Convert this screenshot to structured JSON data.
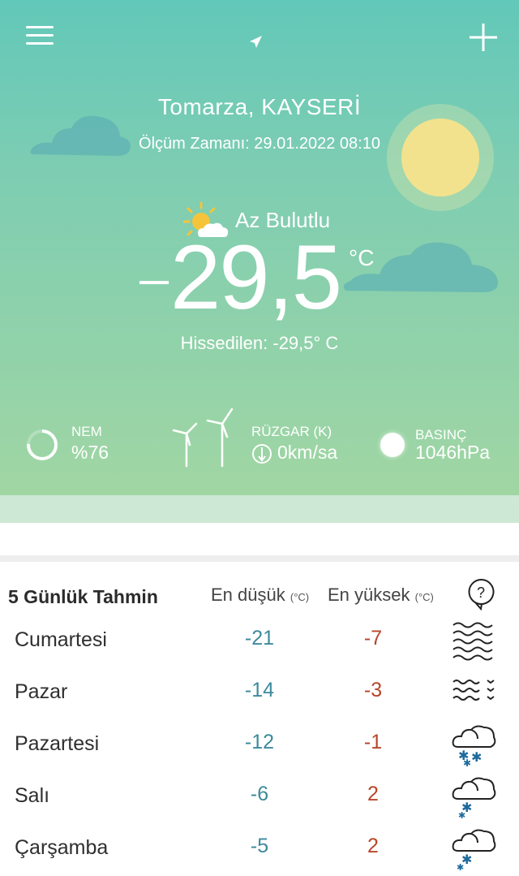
{
  "header": {
    "menu_icon": "hamburger-menu-icon",
    "location_icon": "location-arrow-icon",
    "add_icon": "plus-icon"
  },
  "location": {
    "city": "Tomarza,  KAYSERİ",
    "measurement_time": "Ölçüm Zamanı: 29.01.2022 08:10"
  },
  "current": {
    "condition": "Az Bulutlu",
    "condition_icon": "partly-cloudy-icon",
    "temperature": "29,5",
    "temperature_sign": "-",
    "unit": "°C",
    "feels_like": "Hissedilen: -29,5° C"
  },
  "stats": {
    "humidity_label": "NEM",
    "humidity_value": "%76",
    "humidity_percent": 76,
    "wind_label": "RÜZGAR (K)",
    "wind_value": "0km/sa",
    "pressure_label": "BASINÇ",
    "pressure_value": "1046hPa"
  },
  "forecast": {
    "title": "5 Günlük Tahmin",
    "low_header": "En düşük",
    "high_header": "En yüksek",
    "unit_header": "(°C)",
    "help_icon": "question-bubble-icon",
    "days": [
      {
        "day": "Cumartesi",
        "low": "-21",
        "high": "-7",
        "icon": "fog-icon"
      },
      {
        "day": "Pazar",
        "low": "-14",
        "high": "-3",
        "icon": "fog-icon"
      },
      {
        "day": "Pazartesi",
        "low": "-12",
        "high": "-1",
        "icon": "cloud-snow-icon"
      },
      {
        "day": "Salı",
        "low": "-6",
        "high": "2",
        "icon": "cloud-snow-icon"
      },
      {
        "day": "Çarşamba",
        "low": "-5",
        "high": "2",
        "icon": "cloud-snow-icon"
      }
    ]
  },
  "colors": {
    "hero_top": "#62c8b9",
    "hero_bottom": "#a1d6a3",
    "low_temp": "#3d8a9c",
    "high_temp": "#b8462a",
    "sun": "#f3e28d"
  }
}
